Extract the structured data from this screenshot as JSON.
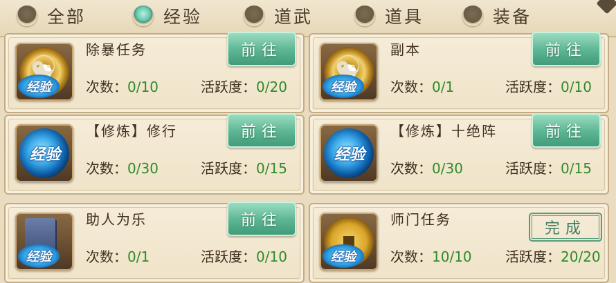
{
  "filters": [
    {
      "label": "全部",
      "selected": false
    },
    {
      "label": "经验",
      "selected": true
    },
    {
      "label": "道武",
      "selected": false
    },
    {
      "label": "道具",
      "selected": false
    },
    {
      "label": "装备",
      "selected": false
    }
  ],
  "badge_text": "经验",
  "count_label": "次数：",
  "active_label": "活跃度：",
  "go_label": "前往",
  "done_label": "完成",
  "tasks": [
    {
      "name": "除暴任务",
      "icon": "taiji-coin-icon",
      "count": "0/10",
      "active": "0/20",
      "action": "go"
    },
    {
      "name": "副本",
      "icon": "taiji-coin-icon",
      "count": "0/1",
      "active": "0/10",
      "action": "go"
    },
    {
      "name": "【修炼】修行",
      "icon": "exp-orb-icon",
      "count": "0/30",
      "active": "0/15",
      "action": "go"
    },
    {
      "name": "【修炼】十绝阵",
      "icon": "exp-orb-icon",
      "count": "0/30",
      "active": "0/15",
      "action": "go"
    },
    {
      "name": "助人为乐",
      "icon": "book-icon",
      "count": "0/1",
      "active": "0/10",
      "action": "go"
    },
    {
      "name": "师门任务",
      "icon": "coin-icon",
      "count": "10/10",
      "active": "20/20",
      "action": "done"
    }
  ],
  "colors": {
    "progress_green": "#2f8a2a",
    "button_green": "#5bb492",
    "card_bg": "#f6ecd8"
  }
}
